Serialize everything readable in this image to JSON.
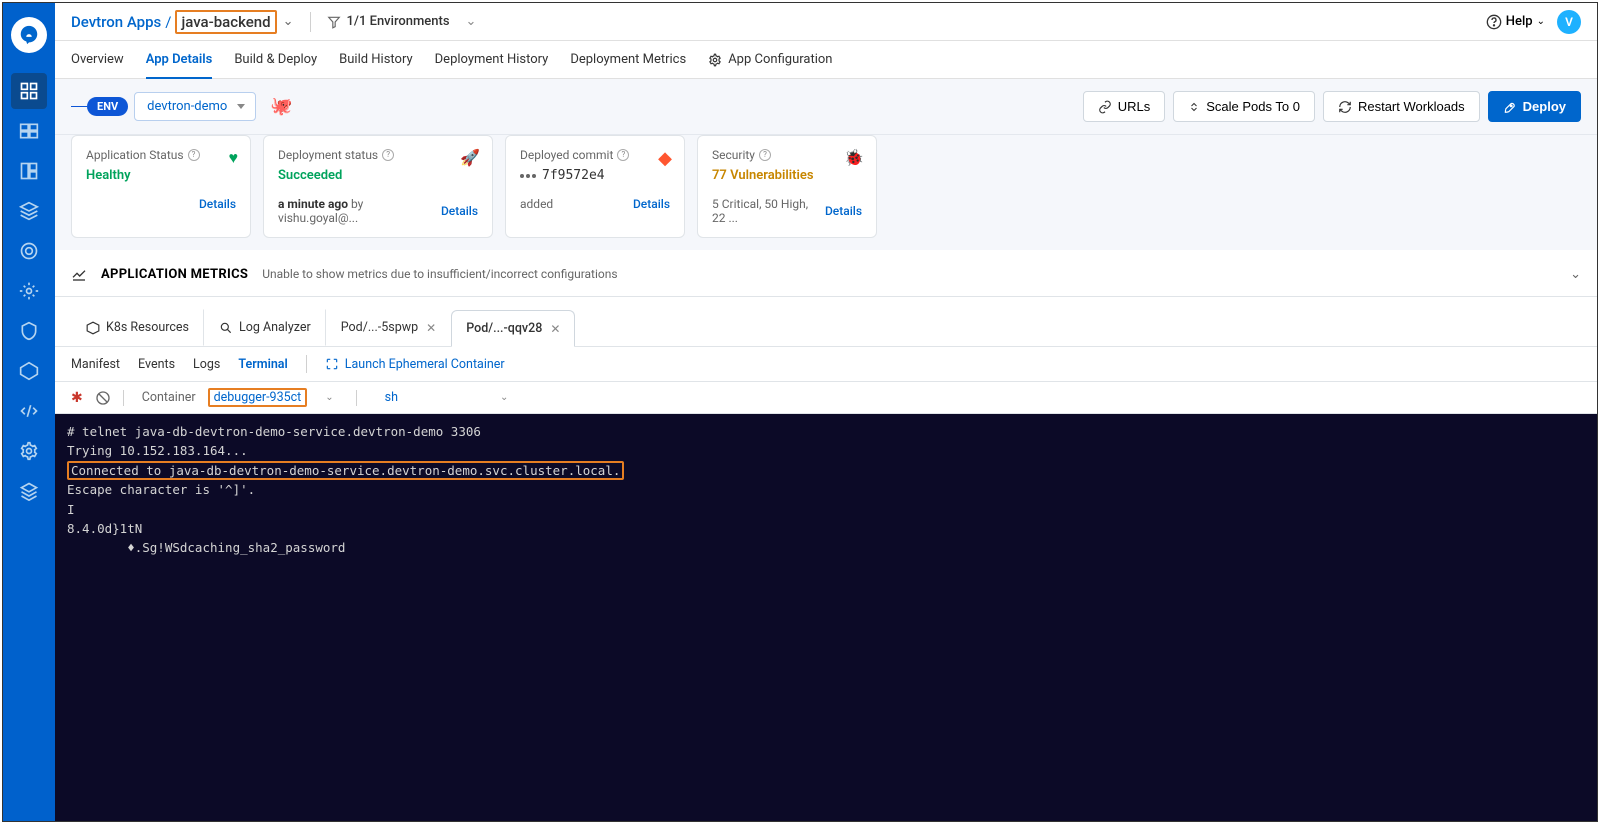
{
  "header": {
    "breadcrumb_root": "Devtron Apps",
    "breadcrumb_current": "java-backend",
    "env_count": "1/1 Environments",
    "help": "Help",
    "avatar": "V"
  },
  "tabs": {
    "overview": "Overview",
    "app_details": "App Details",
    "build_deploy": "Build & Deploy",
    "build_history": "Build History",
    "deployment_history": "Deployment History",
    "deployment_metrics": "Deployment Metrics",
    "app_config": "App Configuration"
  },
  "env": {
    "pill": "ENV",
    "selected": "devtron-demo",
    "urls": "URLs",
    "scale_pods": "Scale Pods To 0",
    "restart": "Restart Workloads",
    "deploy": "Deploy"
  },
  "cards": {
    "app_status": {
      "title": "Application Status",
      "value": "Healthy",
      "details": "Details"
    },
    "deploy_status": {
      "title": "Deployment status",
      "value": "Succeeded",
      "time": "a minute ago",
      "by": "by vishu.goyal@...",
      "details": "Details"
    },
    "commit": {
      "title": "Deployed commit",
      "value": "7f9572e4",
      "added": "added",
      "details": "Details"
    },
    "security": {
      "title": "Security",
      "value": "77 Vulnerabilities",
      "summary": "5 Critical, 50 High, 22 ...",
      "details": "Details"
    }
  },
  "metrics": {
    "title": "APPLICATION METRICS",
    "sub": "Unable to show metrics due to insufficient/incorrect configurations"
  },
  "subtabs": {
    "k8s": "K8s Resources",
    "log": "Log Analyzer",
    "pod1": "Pod/...-5spwp",
    "pod2": "Pod/...-qqv28"
  },
  "termtabs": {
    "manifest": "Manifest",
    "events": "Events",
    "logs": "Logs",
    "terminal": "Terminal",
    "launch": "Launch Ephemeral Container"
  },
  "termctrl": {
    "container_label": "Container",
    "container_value": "debugger-935ct",
    "shell": "sh"
  },
  "terminal": {
    "l1": "# telnet java-db-devtron-demo-service.devtron-demo 3306",
    "l2": "Trying 10.152.183.164...",
    "l3": "Connected to java-db-devtron-demo-service.devtron-demo.svc.cluster.local.",
    "l4": "Escape character is '^]'.",
    "l5": "I",
    "l6": "8.4.0d}1tN",
    "l7": "        ♦.Sg!WSdcaching_sha2_password"
  }
}
